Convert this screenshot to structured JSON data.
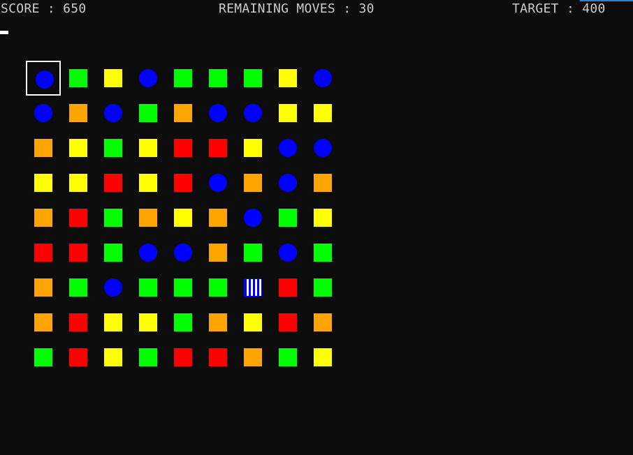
{
  "hud": {
    "score_text": "SCORE : 650",
    "moves_text": "REMAINING MOVES : 30",
    "target_text": "TARGET : 400"
  },
  "colors": {
    "blue": "#0000ff",
    "green": "#00ff00",
    "yellow": "#ffff00",
    "orange": "#ffa500",
    "red": "#ff0000",
    "white": "#ffffff",
    "accent": "#2f7fd6",
    "text": "#cccccc",
    "background": "#0c0c0c"
  },
  "board": {
    "rows": 9,
    "cols": 9,
    "selected": [
      0,
      0
    ],
    "grid": [
      [
        "blue-circle",
        "green-square",
        "yellow-square",
        "blue-circle",
        "green-square",
        "green-square",
        "green-square",
        "yellow-square",
        "blue-circle"
      ],
      [
        "blue-circle",
        "orange-square",
        "blue-circle",
        "green-square",
        "orange-square",
        "blue-circle",
        "blue-circle",
        "yellow-square",
        "yellow-square"
      ],
      [
        "orange-square",
        "yellow-square",
        "green-square",
        "yellow-square",
        "red-square",
        "red-square",
        "yellow-square",
        "blue-circle",
        "blue-circle"
      ],
      [
        "yellow-square",
        "yellow-square",
        "red-square",
        "yellow-square",
        "red-square",
        "blue-circle",
        "orange-square",
        "blue-circle",
        "orange-square"
      ],
      [
        "orange-square",
        "red-square",
        "green-square",
        "orange-square",
        "yellow-square",
        "orange-square",
        "blue-circle",
        "green-square",
        "yellow-square"
      ],
      [
        "red-square",
        "red-square",
        "green-square",
        "blue-circle",
        "blue-circle",
        "orange-square",
        "green-square",
        "blue-circle",
        "green-square"
      ],
      [
        "orange-square",
        "green-square",
        "blue-circle",
        "green-square",
        "green-square",
        "green-square",
        "blue-striped",
        "red-square",
        "green-square"
      ],
      [
        "orange-square",
        "red-square",
        "yellow-square",
        "yellow-square",
        "green-square",
        "orange-square",
        "yellow-square",
        "red-square",
        "orange-square"
      ],
      [
        "green-square",
        "red-square",
        "yellow-square",
        "green-square",
        "red-square",
        "red-square",
        "orange-square",
        "green-square",
        "yellow-square"
      ]
    ]
  }
}
